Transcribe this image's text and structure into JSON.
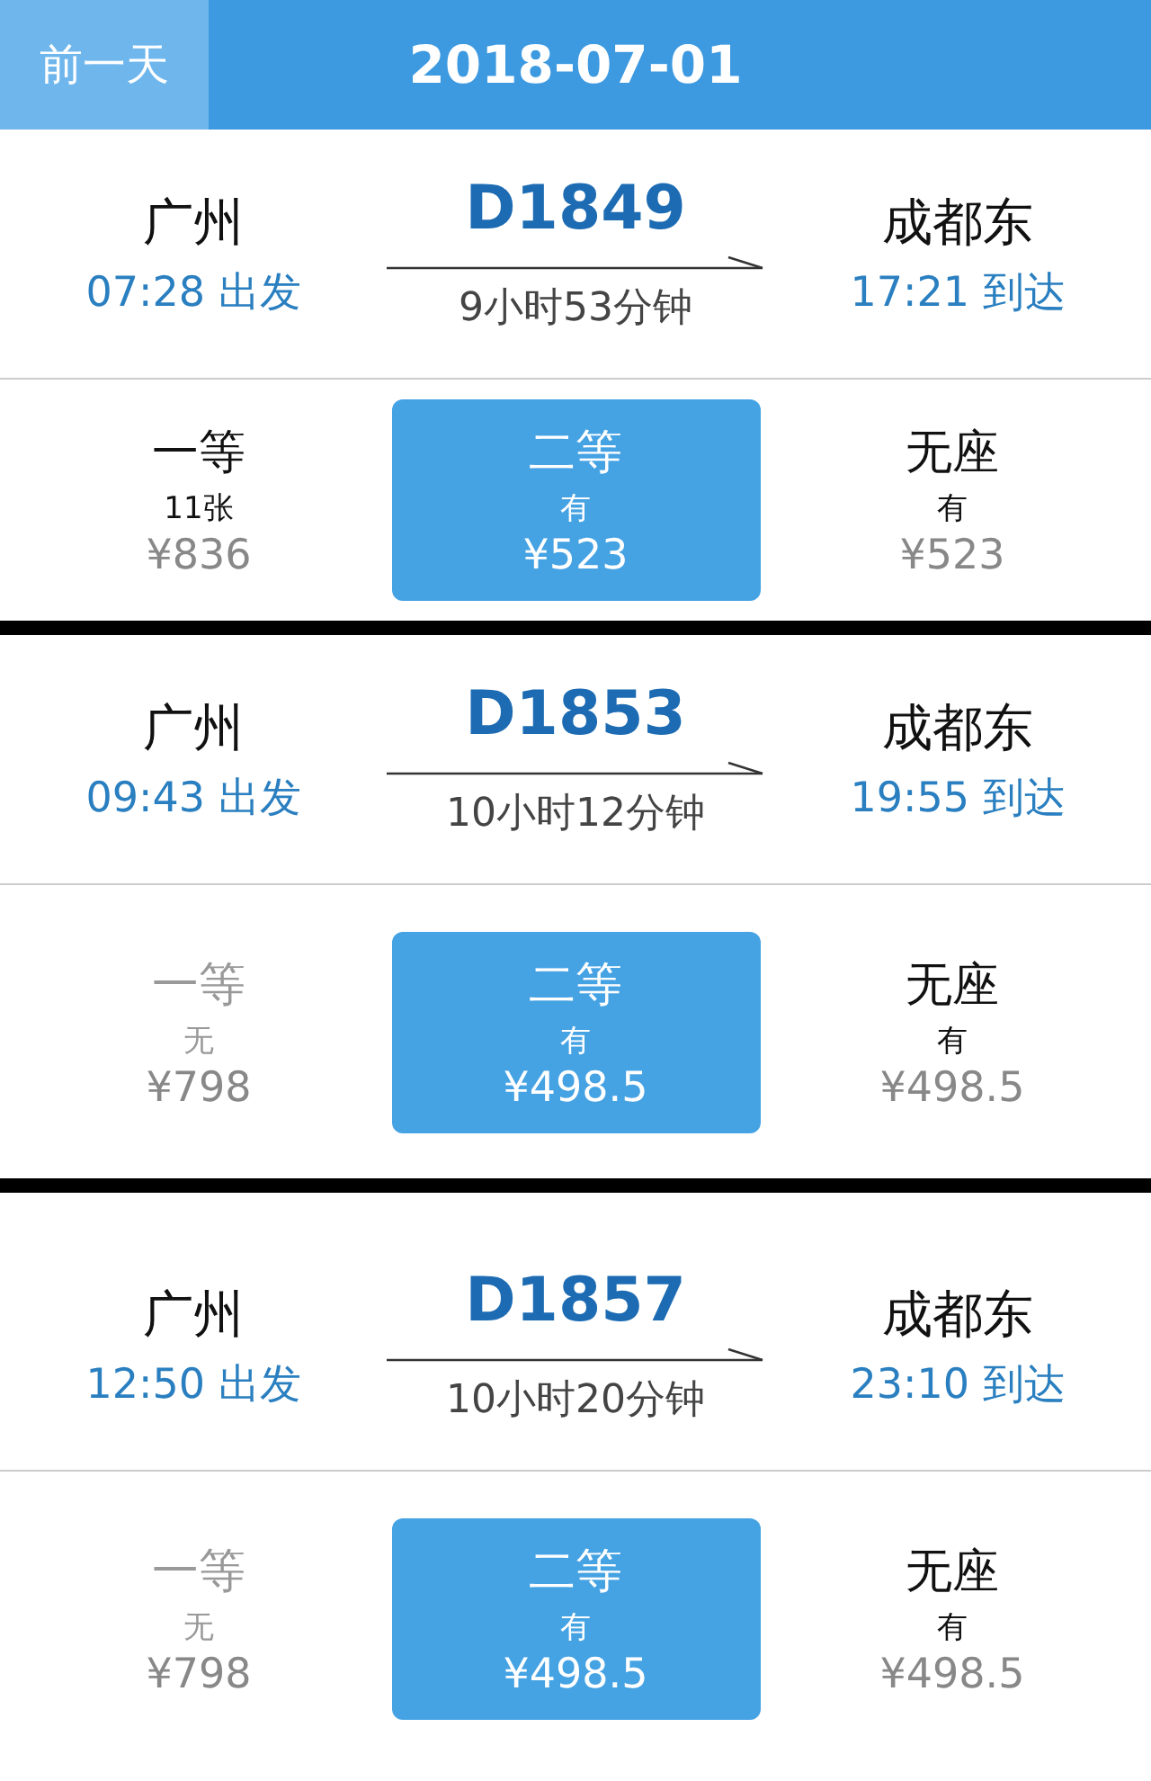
{
  "header": {
    "prev_button": "前一天",
    "date": "2018-07-01"
  },
  "trains": [
    {
      "from": "广州",
      "depart": "07:28 出发",
      "number": "D1849",
      "duration": "9小时53分钟",
      "to": "成都东",
      "arrive": "17:21 到达",
      "seats": [
        {
          "name": "一等",
          "availability": "11张",
          "price": "¥836",
          "selected": false,
          "available": true
        },
        {
          "name": "二等",
          "availability": "有",
          "price": "¥523",
          "selected": true,
          "available": true
        },
        {
          "name": "无座",
          "availability": "有",
          "price": "¥523",
          "selected": false,
          "available": true
        }
      ]
    },
    {
      "from": "广州",
      "depart": "09:43 出发",
      "number": "D1853",
      "duration": "10小时12分钟",
      "to": "成都东",
      "arrive": "19:55 到达",
      "seats": [
        {
          "name": "一等",
          "availability": "无",
          "price": "¥798",
          "selected": false,
          "available": false
        },
        {
          "name": "二等",
          "availability": "有",
          "price": "¥498.5",
          "selected": true,
          "available": true
        },
        {
          "name": "无座",
          "availability": "有",
          "price": "¥498.5",
          "selected": false,
          "available": true
        }
      ]
    },
    {
      "from": "广州",
      "depart": "12:50 出发",
      "number": "D1857",
      "duration": "10小时20分钟",
      "to": "成都东",
      "arrive": "23:10 到达",
      "seats": [
        {
          "name": "一等",
          "availability": "无",
          "price": "¥798",
          "selected": false,
          "available": false
        },
        {
          "name": "二等",
          "availability": "有",
          "price": "¥498.5",
          "selected": true,
          "available": true
        },
        {
          "name": "无座",
          "availability": "有",
          "price": "¥498.5",
          "selected": false,
          "available": true
        }
      ]
    }
  ]
}
